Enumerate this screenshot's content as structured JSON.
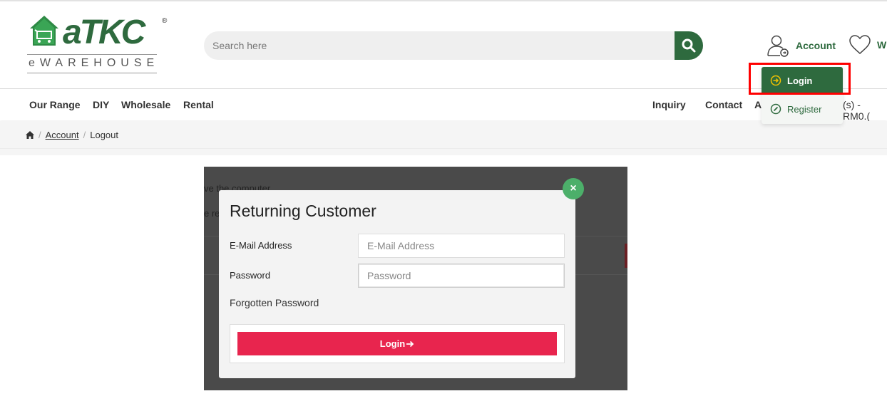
{
  "logo": {
    "brand": "aTKC",
    "registered": "®",
    "subtitle": "eWAREHOUSE",
    "icon": "house-cart-icon"
  },
  "search": {
    "placeholder": "Search here",
    "icon": "search-icon"
  },
  "header": {
    "account_label": "Account",
    "account_icon": "user-login-icon",
    "wishlist_label": "W",
    "wishlist_icon": "heart-icon"
  },
  "account_dropdown": {
    "login_label": "Login",
    "login_icon": "login-arrow-icon",
    "register_label": "Register",
    "register_icon": "register-pencil-icon"
  },
  "nav": {
    "left_items": [
      "Our Range",
      "DIY",
      "Wholesale",
      "Rental"
    ],
    "right_items": [
      "Inquiry",
      "Contact",
      "A"
    ],
    "cart_summary": "(s) - RM0.("
  },
  "breadcrumb": {
    "home_icon": "home-icon",
    "items": [
      "Account",
      "Logout"
    ]
  },
  "background_text": {
    "line1": "ve the computer.",
    "line2": "e re"
  },
  "login_modal": {
    "title": "Returning Customer",
    "email_label": "E-Mail Address",
    "email_placeholder": "E-Mail Address",
    "password_label": "Password",
    "password_placeholder": "Password",
    "forgot_label": "Forgotten Password",
    "submit_label": "Login",
    "submit_icon": "arrow-right-icon",
    "close_symbol": "×"
  },
  "colors": {
    "brand_green": "#2e6a3e",
    "login_red": "#e8254e",
    "close_green": "#4caf6a",
    "highlight": "#ff0000"
  }
}
